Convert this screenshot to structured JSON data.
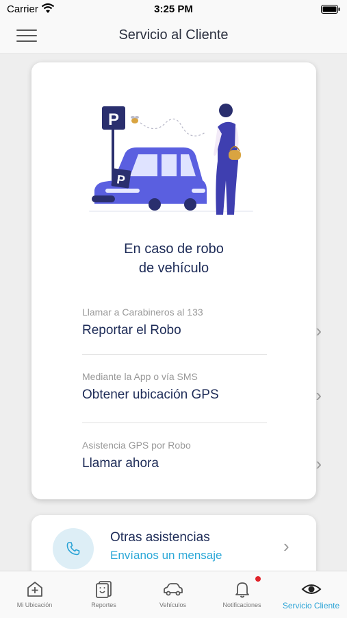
{
  "status_bar": {
    "carrier": "Carrier",
    "time": "3:25 PM"
  },
  "nav": {
    "title": "Servicio al Cliente",
    "menu_icon": "hamburger-menu-icon"
  },
  "main_card": {
    "heading_line1": "En caso de robo",
    "heading_line2": "de vehículo",
    "options": [
      {
        "sub": "Llamar a Carabineros al 133",
        "main": "Reportar el Robo"
      },
      {
        "sub": "Mediante la App o vía SMS",
        "main": "Obtener ubicación GPS"
      },
      {
        "sub": "Asistencia GPS por Robo",
        "main": "Llamar ahora"
      }
    ]
  },
  "second_card": {
    "title": "Otras asistencias",
    "subtitle": "Envíanos un mensaje",
    "icon": "phone-icon"
  },
  "tabs": [
    {
      "label": "Mi Ubicación",
      "icon": "location-add-icon"
    },
    {
      "label": "Reportes",
      "icon": "reports-icon"
    },
    {
      "label": "Vehículos",
      "icon": "car-icon"
    },
    {
      "label": "Notificaciones",
      "icon": "bell-icon"
    },
    {
      "label": "Servicio Cliente",
      "icon": "eye-icon",
      "active": true
    }
  ],
  "colors": {
    "primary_text": "#1d2b57",
    "accent": "#2aa3d6",
    "illustration_blue": "#5a5fe0",
    "notification_dot": "#e0242b"
  }
}
